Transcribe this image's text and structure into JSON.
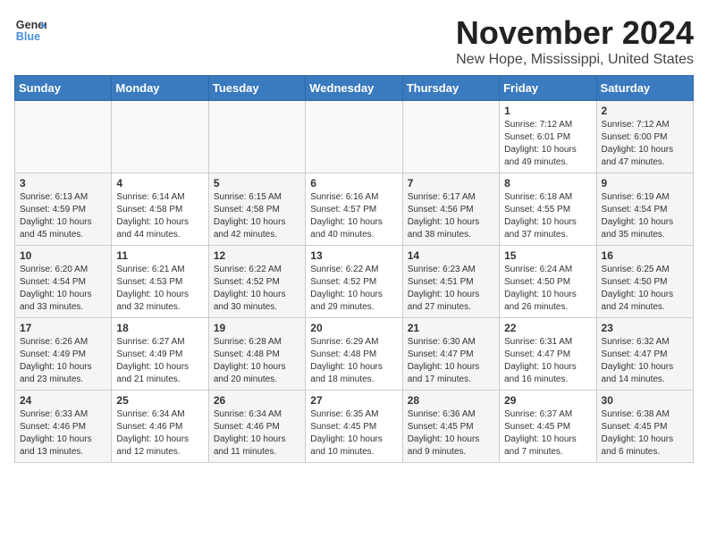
{
  "header": {
    "logo_line1": "General",
    "logo_line2": "Blue",
    "month": "November 2024",
    "location": "New Hope, Mississippi, United States"
  },
  "weekdays": [
    "Sunday",
    "Monday",
    "Tuesday",
    "Wednesday",
    "Thursday",
    "Friday",
    "Saturday"
  ],
  "weeks": [
    [
      {
        "day": "",
        "info": ""
      },
      {
        "day": "",
        "info": ""
      },
      {
        "day": "",
        "info": ""
      },
      {
        "day": "",
        "info": ""
      },
      {
        "day": "",
        "info": ""
      },
      {
        "day": "1",
        "info": "Sunrise: 7:12 AM\nSunset: 6:01 PM\nDaylight: 10 hours\nand 49 minutes."
      },
      {
        "day": "2",
        "info": "Sunrise: 7:12 AM\nSunset: 6:00 PM\nDaylight: 10 hours\nand 47 minutes."
      }
    ],
    [
      {
        "day": "3",
        "info": "Sunrise: 6:13 AM\nSunset: 4:59 PM\nDaylight: 10 hours\nand 45 minutes."
      },
      {
        "day": "4",
        "info": "Sunrise: 6:14 AM\nSunset: 4:58 PM\nDaylight: 10 hours\nand 44 minutes."
      },
      {
        "day": "5",
        "info": "Sunrise: 6:15 AM\nSunset: 4:58 PM\nDaylight: 10 hours\nand 42 minutes."
      },
      {
        "day": "6",
        "info": "Sunrise: 6:16 AM\nSunset: 4:57 PM\nDaylight: 10 hours\nand 40 minutes."
      },
      {
        "day": "7",
        "info": "Sunrise: 6:17 AM\nSunset: 4:56 PM\nDaylight: 10 hours\nand 38 minutes."
      },
      {
        "day": "8",
        "info": "Sunrise: 6:18 AM\nSunset: 4:55 PM\nDaylight: 10 hours\nand 37 minutes."
      },
      {
        "day": "9",
        "info": "Sunrise: 6:19 AM\nSunset: 4:54 PM\nDaylight: 10 hours\nand 35 minutes."
      }
    ],
    [
      {
        "day": "10",
        "info": "Sunrise: 6:20 AM\nSunset: 4:54 PM\nDaylight: 10 hours\nand 33 minutes."
      },
      {
        "day": "11",
        "info": "Sunrise: 6:21 AM\nSunset: 4:53 PM\nDaylight: 10 hours\nand 32 minutes."
      },
      {
        "day": "12",
        "info": "Sunrise: 6:22 AM\nSunset: 4:52 PM\nDaylight: 10 hours\nand 30 minutes."
      },
      {
        "day": "13",
        "info": "Sunrise: 6:22 AM\nSunset: 4:52 PM\nDaylight: 10 hours\nand 29 minutes."
      },
      {
        "day": "14",
        "info": "Sunrise: 6:23 AM\nSunset: 4:51 PM\nDaylight: 10 hours\nand 27 minutes."
      },
      {
        "day": "15",
        "info": "Sunrise: 6:24 AM\nSunset: 4:50 PM\nDaylight: 10 hours\nand 26 minutes."
      },
      {
        "day": "16",
        "info": "Sunrise: 6:25 AM\nSunset: 4:50 PM\nDaylight: 10 hours\nand 24 minutes."
      }
    ],
    [
      {
        "day": "17",
        "info": "Sunrise: 6:26 AM\nSunset: 4:49 PM\nDaylight: 10 hours\nand 23 minutes."
      },
      {
        "day": "18",
        "info": "Sunrise: 6:27 AM\nSunset: 4:49 PM\nDaylight: 10 hours\nand 21 minutes."
      },
      {
        "day": "19",
        "info": "Sunrise: 6:28 AM\nSunset: 4:48 PM\nDaylight: 10 hours\nand 20 minutes."
      },
      {
        "day": "20",
        "info": "Sunrise: 6:29 AM\nSunset: 4:48 PM\nDaylight: 10 hours\nand 18 minutes."
      },
      {
        "day": "21",
        "info": "Sunrise: 6:30 AM\nSunset: 4:47 PM\nDaylight: 10 hours\nand 17 minutes."
      },
      {
        "day": "22",
        "info": "Sunrise: 6:31 AM\nSunset: 4:47 PM\nDaylight: 10 hours\nand 16 minutes."
      },
      {
        "day": "23",
        "info": "Sunrise: 6:32 AM\nSunset: 4:47 PM\nDaylight: 10 hours\nand 14 minutes."
      }
    ],
    [
      {
        "day": "24",
        "info": "Sunrise: 6:33 AM\nSunset: 4:46 PM\nDaylight: 10 hours\nand 13 minutes."
      },
      {
        "day": "25",
        "info": "Sunrise: 6:34 AM\nSunset: 4:46 PM\nDaylight: 10 hours\nand 12 minutes."
      },
      {
        "day": "26",
        "info": "Sunrise: 6:34 AM\nSunset: 4:46 PM\nDaylight: 10 hours\nand 11 minutes."
      },
      {
        "day": "27",
        "info": "Sunrise: 6:35 AM\nSunset: 4:45 PM\nDaylight: 10 hours\nand 10 minutes."
      },
      {
        "day": "28",
        "info": "Sunrise: 6:36 AM\nSunset: 4:45 PM\nDaylight: 10 hours\nand 9 minutes."
      },
      {
        "day": "29",
        "info": "Sunrise: 6:37 AM\nSunset: 4:45 PM\nDaylight: 10 hours\nand 7 minutes."
      },
      {
        "day": "30",
        "info": "Sunrise: 6:38 AM\nSunset: 4:45 PM\nDaylight: 10 hours\nand 6 minutes."
      }
    ]
  ]
}
